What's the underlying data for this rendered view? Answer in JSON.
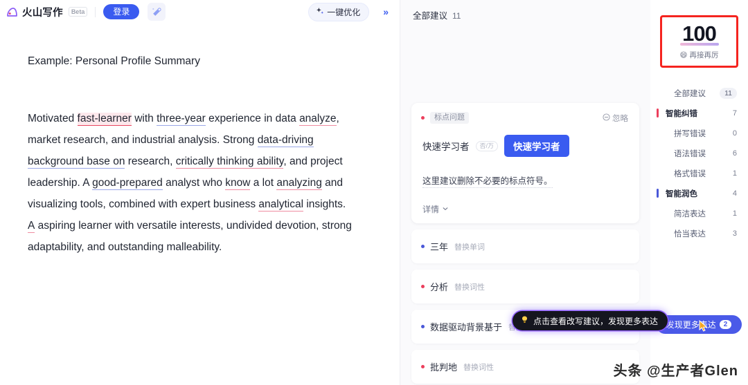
{
  "header": {
    "brand_name": "火山写作",
    "beta_label": "Beta",
    "login_label": "登录",
    "wand_icon": "magic-wand-icon",
    "optimize_label": "一键优化",
    "optimize_icon": "sparkle-icon",
    "collapse_icon": "double-chevron-right-icon"
  },
  "document": {
    "title": "Example: Personal Profile Summary",
    "paragraph_segments": [
      {
        "text": "Motivated ",
        "mark": "none"
      },
      {
        "text": "fast-learner",
        "mark": "red-highlight"
      },
      {
        "text": " with ",
        "mark": "none"
      },
      {
        "text": "three-year",
        "mark": "blue-underline"
      },
      {
        "text": " experience in data ",
        "mark": "none"
      },
      {
        "text": "analyze",
        "mark": "red-underline"
      },
      {
        "text": ", market research, and industrial analysis. Strong ",
        "mark": "none"
      },
      {
        "text": "data-driving background base on",
        "mark": "blue-underline"
      },
      {
        "text": " research, ",
        "mark": "none"
      },
      {
        "text": "critically thinking ability",
        "mark": "red-underline"
      },
      {
        "text": ", and project leadership. A ",
        "mark": "none"
      },
      {
        "text": "good-prepared",
        "mark": "blue-underline"
      },
      {
        "text": " analyst who ",
        "mark": "none"
      },
      {
        "text": "know",
        "mark": "red-underline"
      },
      {
        "text": " a lot ",
        "mark": "none"
      },
      {
        "text": "analyzing",
        "mark": "red-underline"
      },
      {
        "text": " and visualizing tools, combined with expert business ",
        "mark": "none"
      },
      {
        "text": "analytical",
        "mark": "red-underline"
      },
      {
        "text": " insights. ",
        "mark": "none"
      },
      {
        "text": "A",
        "mark": "red-underline"
      },
      {
        "text": " aspiring learner with versatile interests, undivided devotion, strong adaptability, and outstanding malleability.",
        "mark": "none"
      }
    ]
  },
  "suggestions": {
    "header_label": "全部建议",
    "header_count": "11",
    "card": {
      "tag": "标点问题",
      "ignore_label": "忽略",
      "ignore_icon": "minus-circle-icon",
      "original_word": "快速学习者",
      "mini_chip": "否/万",
      "replacement_word": "快速学习者",
      "description": "这里建议删除不必要的标点符号。",
      "more_label": "详情",
      "more_icon": "chevron-down-icon"
    },
    "items": [
      {
        "word": "三年",
        "action": "替换单词",
        "dot": "blue"
      },
      {
        "word": "分析",
        "action": "替换词性",
        "dot": "red"
      },
      {
        "word": "数据驱动背景基于",
        "action": "替换",
        "dot": "blue"
      },
      {
        "word": "批判地",
        "action": "替换词性",
        "dot": "red"
      }
    ]
  },
  "tooltip": {
    "icon": "lightbulb-icon",
    "text": "点击查看改写建议，发现更多表达"
  },
  "sidebar": {
    "score": "100",
    "score_sub": "再接再厉",
    "score_emoji": "😄",
    "categories": [
      {
        "label": "全部建议",
        "count": "11",
        "kind": "all",
        "marker": "none"
      },
      {
        "label": "智能纠错",
        "count": "7",
        "kind": "group",
        "marker": "red"
      },
      {
        "label": "拼写错误",
        "count": "0",
        "kind": "sub",
        "marker": "none"
      },
      {
        "label": "语法错误",
        "count": "6",
        "kind": "sub",
        "marker": "none"
      },
      {
        "label": "格式错误",
        "count": "1",
        "kind": "sub",
        "marker": "none"
      },
      {
        "label": "智能润色",
        "count": "4",
        "kind": "group",
        "marker": "blue"
      },
      {
        "label": "简洁表达",
        "count": "1",
        "kind": "sub",
        "marker": "none"
      },
      {
        "label": "恰当表达",
        "count": "3",
        "kind": "sub",
        "marker": "none"
      }
    ],
    "discover_label": "发现更多表达",
    "discover_badge": "2"
  },
  "watermark": "头条 @生产者Glen",
  "colors": {
    "accent_blue": "#3a5bf0",
    "error_red": "#ec3f5c",
    "polish_blue": "#4a58d8",
    "annotation_red": "#f5241f"
  }
}
